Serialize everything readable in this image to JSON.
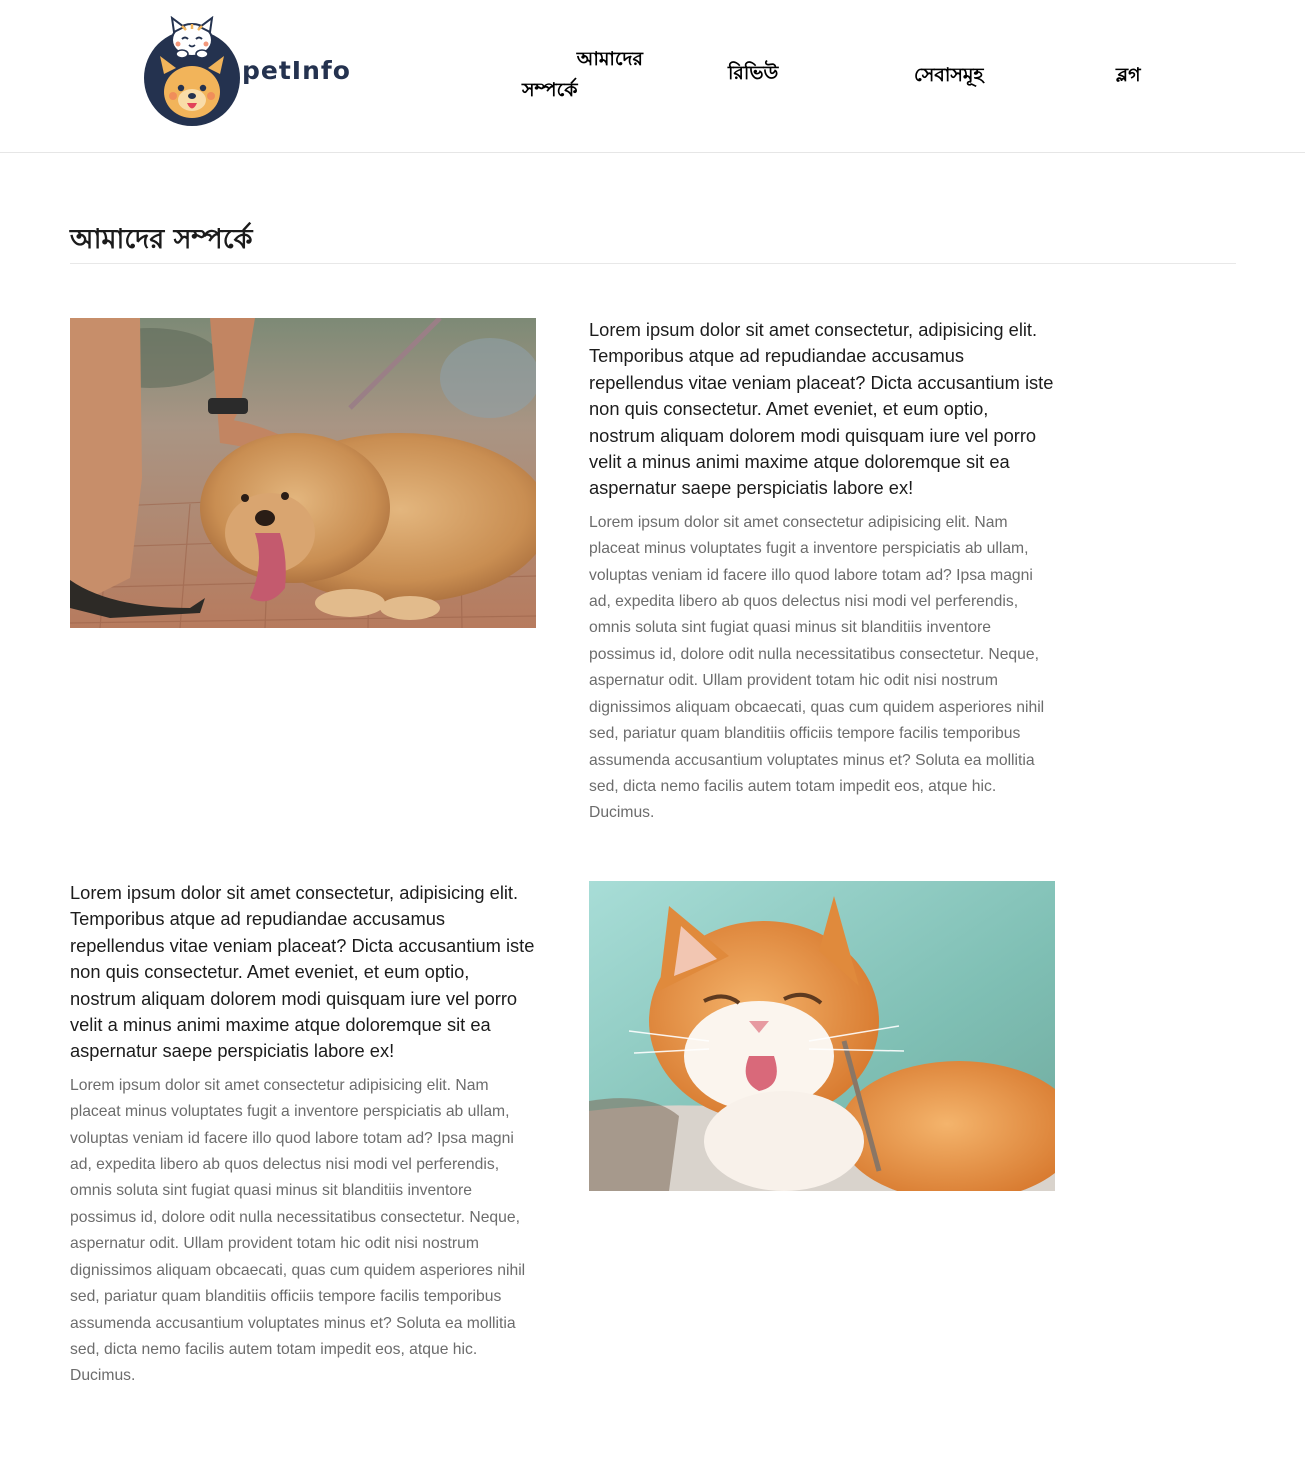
{
  "header": {
    "brand_name": "petInfo",
    "nav": {
      "about_line1": "আমাদের",
      "about_line2": "সম্পর্কে",
      "review": "রিভিউ",
      "services": "সেবাসমূহ",
      "blog": "ব্লগ"
    }
  },
  "main": {
    "title": "আমাদের সম্পর্কে",
    "sections": [
      {
        "image": "dog-photo",
        "lead": "Lorem ipsum dolor sit amet consectetur, adipisicing elit. Temporibus atque ad repudiandae accusamus repellendus vitae veniam placeat? Dicta accusantium iste non quis consectetur. Amet eveniet, et eum optio, nostrum aliquam dolorem modi quisquam iure vel porro velit a minus animi maxime atque doloremque sit ea aspernatur saepe perspiciatis labore ex!",
        "body": "Lorem ipsum dolor sit amet consectetur adipisicing elit. Nam placeat minus voluptates fugit a inventore perspiciatis ab ullam, voluptas veniam id facere illo quod labore totam ad? Ipsa magni ad, expedita libero ab quos delectus nisi modi vel perferendis, omnis soluta sint fugiat quasi minus sit blanditiis inventore possimus id, dolore odit nulla necessitatibus consectetur. Neque, aspernatur odit. Ullam provident totam hic odit nisi nostrum dignissimos aliquam obcaecati, quas cum quidem asperiores nihil sed, pariatur quam blanditiis officiis tempore facilis temporibus assumenda accusantium voluptates minus et? Soluta ea mollitia sed, dicta nemo facilis autem totam impedit eos, atque hic. Ducimus."
      },
      {
        "image": "cat-photo",
        "lead": "Lorem ipsum dolor sit amet consectetur, adipisicing elit. Temporibus atque ad repudiandae accusamus repellendus vitae veniam placeat? Dicta accusantium iste non quis consectetur. Amet eveniet, et eum optio, nostrum aliquam dolorem modi quisquam iure vel porro velit a minus animi maxime atque doloremque sit ea aspernatur saepe perspiciatis labore ex!",
        "body": "Lorem ipsum dolor sit amet consectetur adipisicing elit. Nam placeat minus voluptates fugit a inventore perspiciatis ab ullam, voluptas veniam id facere illo quod labore totam ad? Ipsa magni ad, expedita libero ab quos delectus nisi modi vel perferendis, omnis soluta sint fugiat quasi minus sit blanditiis inventore possimus id, dolore odit nulla necessitatibus consectetur. Neque, aspernatur odit. Ullam provident totam hic odit nisi nostrum dignissimos aliquam obcaecati, quas cum quidem asperiores nihil sed, pariatur quam blanditiis officiis tempore facilis temporibus assumenda accusantium voluptates minus et? Soluta ea mollitia sed, dicta nemo facilis autem totam impedit eos, atque hic. Ducimus."
      }
    ]
  },
  "colors": {
    "brand_navy": "#24324f",
    "logo_dog": "#f2b45a",
    "text_dark": "#1c1c1c",
    "text_muted": "#6c6c6c"
  }
}
